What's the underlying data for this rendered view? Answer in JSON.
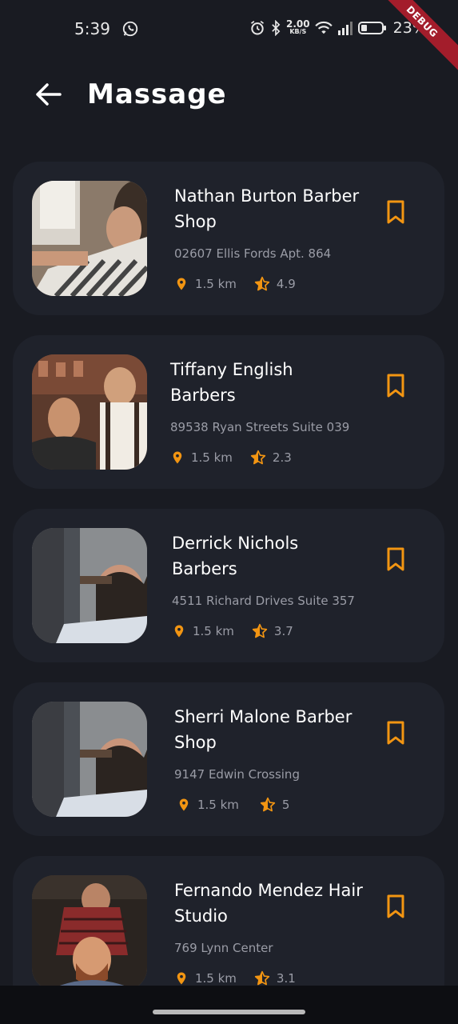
{
  "status_bar": {
    "time": "5:39",
    "speed_value": "2.00",
    "speed_unit": "KB/S",
    "battery": "23%",
    "debug_label": "DEBUG"
  },
  "header": {
    "title": "Massage"
  },
  "colors": {
    "accent": "#f29512",
    "background": "#191b22",
    "card": "#1f222b",
    "muted_text": "#9a9ca6"
  },
  "shops": [
    {
      "name": "Nathan Burton Barber Shop",
      "address": "02607 Ellis Fords Apt. 864",
      "distance": "1.5 km",
      "rating": "4.9"
    },
    {
      "name": "Tiffany English Barbers",
      "address": "89538 Ryan Streets Suite 039",
      "distance": "1.5 km",
      "rating": "2.3"
    },
    {
      "name": "Derrick Nichols Barbers",
      "address": "4511 Richard Drives Suite 357",
      "distance": "1.5 km",
      "rating": "3.7"
    },
    {
      "name": "Sherri Malone Barber Shop",
      "address": "9147 Edwin Crossing",
      "distance": "1.5 km",
      "rating": "5"
    },
    {
      "name": "Fernando Mendez Hair Studio",
      "address": "769 Lynn Center",
      "distance": "1.5 km",
      "rating": "3.1"
    }
  ]
}
